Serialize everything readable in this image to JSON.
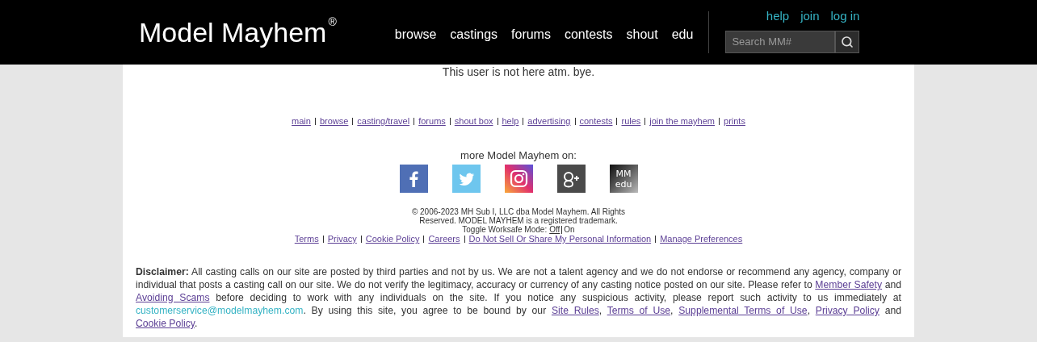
{
  "header": {
    "logo": {
      "name": "Model Mayhem",
      "mark": "®"
    },
    "nav": [
      "browse",
      "castings",
      "forums",
      "contests",
      "shout",
      "edu"
    ],
    "account_links": [
      "help",
      "join",
      "log in"
    ],
    "search": {
      "placeholder": "Search MM#"
    }
  },
  "message": "This user is not here atm. bye.",
  "site_links": [
    "main",
    "browse",
    "casting/travel",
    "forums",
    "shout box",
    "help",
    "advertising",
    "contests",
    "rules",
    "join the mayhem",
    "prints"
  ],
  "social": {
    "heading": "more Model Mayhem on:",
    "icons": [
      {
        "kind": "facebook"
      },
      {
        "kind": "twitter"
      },
      {
        "kind": "instagram"
      },
      {
        "kind": "googleplus"
      },
      {
        "kind": "edu",
        "lines": [
          "MM",
          "edu"
        ]
      }
    ]
  },
  "copyright": [
    "© 2006-2023 MH Sub I, LLC dba Model Mayhem. All Rights",
    "Reserved. MODEL MAYHEM is a registered trademark."
  ],
  "worksafe": {
    "label": "Toggle Worksafe Mode:",
    "options": [
      {
        "label": "Off",
        "selected": false
      },
      {
        "label": "On",
        "selected": true
      }
    ]
  },
  "legal_links": [
    "Terms",
    "Privacy",
    "Cookie Policy",
    "Careers",
    "Do Not Sell Or Share My Personal Information",
    "Manage Preferences"
  ],
  "disclaimer": [
    {
      "kind": "bold",
      "text": "Disclaimer:"
    },
    {
      "kind": "text",
      "text": " All casting calls on our site are posted by third parties and not by us. We are not a talent agency and we do not endorse or recommend any agency, company or individual that posts a casting call on our site. We do not verify the legitimacy, accuracy or currency of any casting notice posted on our site. Please refer to "
    },
    {
      "kind": "link",
      "text": "Member Safety"
    },
    {
      "kind": "text",
      "text": " and "
    },
    {
      "kind": "link",
      "text": "Avoiding Scams"
    },
    {
      "kind": "text",
      "text": " before deciding to work with any individuals on the site. If you notice any suspicious activity, please report such activity to us immediately at "
    },
    {
      "kind": "email",
      "text": "customerservice@modelmayhem.com"
    },
    {
      "kind": "text",
      "text": ". By using this site, you agree to be bound by our "
    },
    {
      "kind": "link",
      "text": "Site Rules"
    },
    {
      "kind": "text",
      "text": ", "
    },
    {
      "kind": "link",
      "text": "Terms of Use"
    },
    {
      "kind": "text",
      "text": ", "
    },
    {
      "kind": "link",
      "text": "Supplemental Terms of Use"
    },
    {
      "kind": "text",
      "text": ", "
    },
    {
      "kind": "link",
      "text": "Privacy Policy"
    },
    {
      "kind": "text",
      "text": " and "
    },
    {
      "kind": "link",
      "text": "Cookie Policy"
    },
    {
      "kind": "text",
      "text": "."
    }
  ]
}
